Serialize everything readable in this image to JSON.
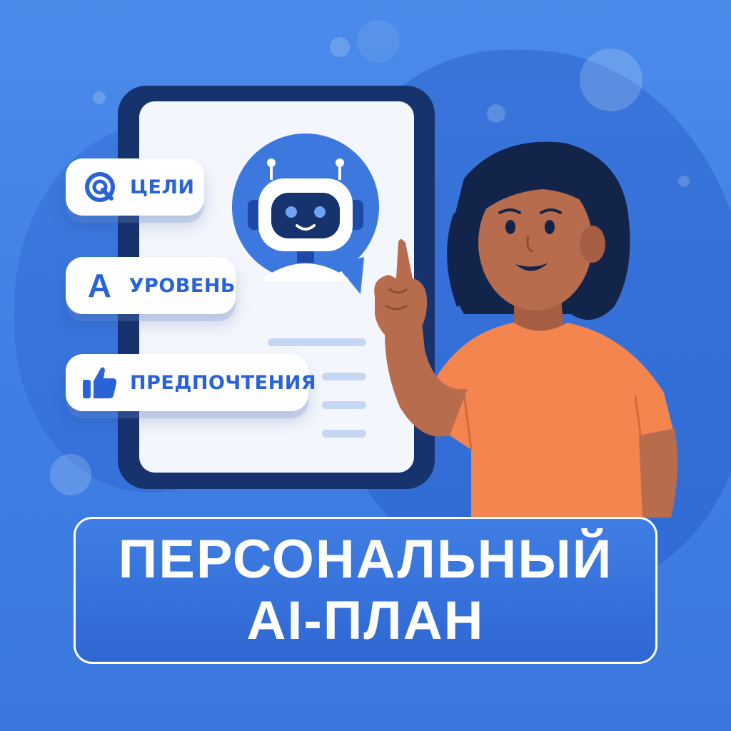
{
  "features": [
    {
      "label": "ЦЕЛИ",
      "icon": "target-icon"
    },
    {
      "label": "УРОВЕНЬ",
      "icon": "letter-a-icon",
      "icon_text": "A"
    },
    {
      "label": "ПРЕДПОЧТЕНИЯ",
      "icon": "thumbs-up-icon"
    }
  ],
  "banner": {
    "line1": "ПЕРСОНАЛЬНЫЙ",
    "line2": "AI-ПЛАН"
  },
  "colors": {
    "background": "#4a8bea",
    "accent": "#2a63d6",
    "tablet_frame": "#17336e",
    "shirt": "#f4854f",
    "skin": "#b86c4e",
    "hair": "#13244a"
  }
}
